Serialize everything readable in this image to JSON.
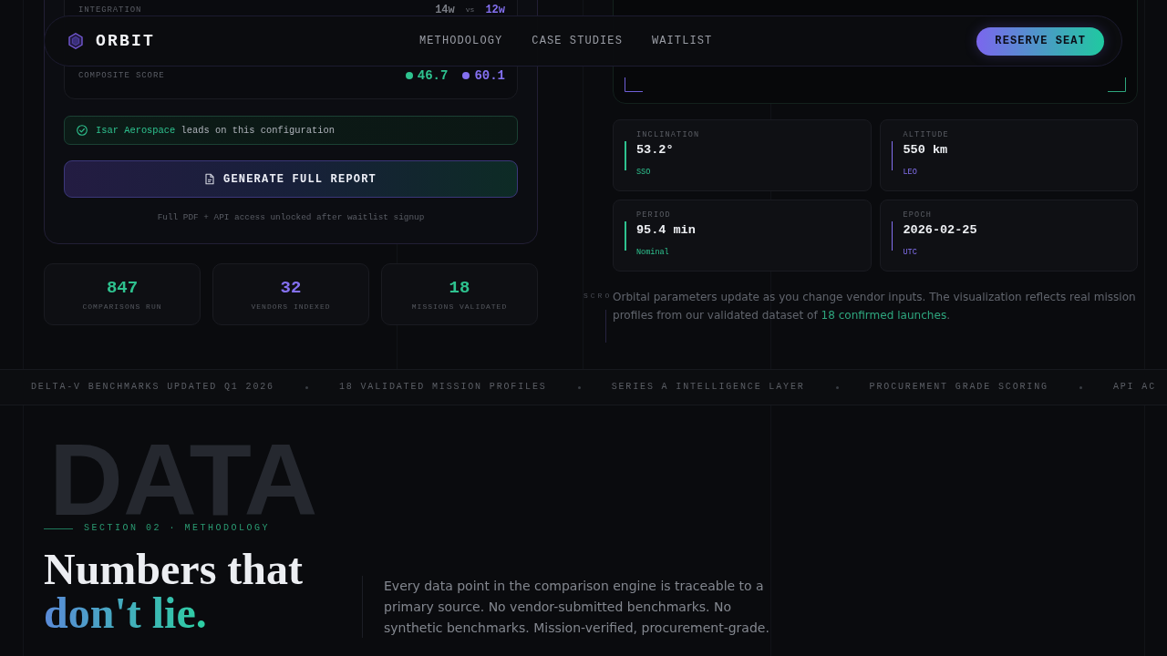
{
  "nav": {
    "brand": "ORBIT",
    "links": [
      {
        "label": "METHODOLOGY"
      },
      {
        "label": "CASE STUDIES"
      },
      {
        "label": "WAITLIST"
      }
    ],
    "cta": "RESERVE SEAT"
  },
  "comparison_card": {
    "rows": [
      {
        "kind": "plain",
        "label": "INTEGRATION",
        "separator": "vs",
        "values": [
          {
            "text": "14w",
            "color": "#7a7d85"
          },
          {
            "text": "12w",
            "color": "#8470f0"
          }
        ]
      },
      {
        "kind": "score",
        "label": "COMPOSITE SCORE",
        "values": [
          {
            "text": "46.7",
            "color": "#2ec28f"
          },
          {
            "text": "60.1",
            "color": "#8470f0"
          }
        ]
      }
    ],
    "leader": {
      "vendor": "Isar Aerospace",
      "text": "leads on this configuration"
    },
    "report_button": "GENERATE FULL REPORT",
    "note": "Full PDF + API access unlocked after waitlist signup"
  },
  "stats": [
    {
      "value": "847",
      "label": "COMPARISONS RUN",
      "color": "#2ec28f"
    },
    {
      "value": "32",
      "label": "VENDORS INDEXED",
      "color": "#8470f0"
    },
    {
      "value": "18",
      "label": "MISSIONS VALIDATED",
      "color": "#2ec28f"
    }
  ],
  "orbit_panel": {
    "parameters": [
      {
        "label": "INCLINATION",
        "value": "53.2°",
        "note": "SSO",
        "color": "#2ec28f"
      },
      {
        "label": "ALTITUDE",
        "value": "550 km",
        "note": "LEO",
        "color": "#8470f0"
      },
      {
        "label": "PERIOD",
        "value": "95.4 min",
        "note": "Nominal",
        "color": "#2ec28f"
      },
      {
        "label": "EPOCH",
        "value": "2026-02-25",
        "note": "UTC",
        "color": "#8470f0"
      }
    ],
    "description": {
      "text": "Orbital parameters update as you change vendor inputs. The visualization reflects real mission profiles from our validated dataset of",
      "link": "18 confirmed launches",
      "after": "."
    },
    "scroll_hint": "SCRO"
  },
  "ticker": [
    "DELTA-V BENCHMARKS UPDATED Q1 2026",
    "18 VALIDATED MISSION PROFILES",
    "SERIES A INTELLIGENCE LAYER",
    "PROCUREMENT GRADE SCORING",
    "API AC"
  ],
  "methodology": {
    "background_word": "DATA",
    "eyebrow": "SECTION 02 · METHODOLOGY",
    "title_lines": [
      "Numbers that",
      "don't lie."
    ],
    "body": "Every data point in the comparison engine is traceable to a primary source. No vendor-submitted benchmarks. No synthetic benchmarks. Mission-verified, procurement-grade."
  }
}
